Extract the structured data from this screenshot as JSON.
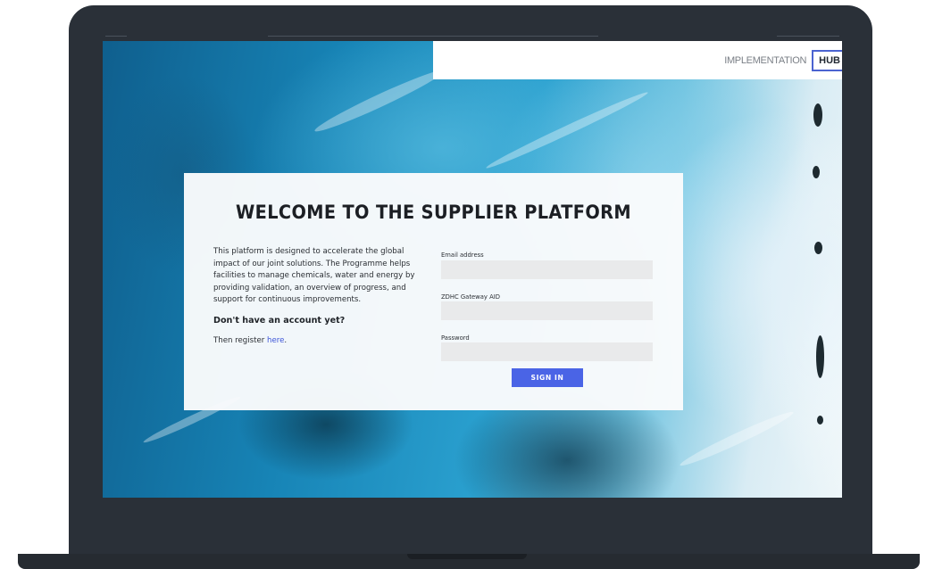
{
  "header": {
    "brand_implementation": "IMPLEMENTATION",
    "brand_hub": "HUB"
  },
  "login": {
    "title": "WELCOME TO THE SUPPLIER PLATFORM",
    "intro": "This platform is designed to accelerate the global impact of our joint solutions. The Programme helps facilities to manage chemicals, water and energy by providing validation, an overview of progress, and support for continuous improvements.",
    "no_account": "Don't have an account yet?",
    "register_prefix": "Then register ",
    "register_link": "here",
    "register_suffix": ".",
    "email_label": "Email address",
    "email_value": "",
    "aid_label": "ZDHC Gateway AID",
    "aid_value": "",
    "password_label": "Password",
    "password_value": "",
    "sign_in_label": "SIGN IN"
  },
  "colors": {
    "accent": "#4a64e6",
    "laptop_frame": "#2a3038",
    "card_background": "#fafbfc",
    "input_background": "#e9eaeb"
  }
}
